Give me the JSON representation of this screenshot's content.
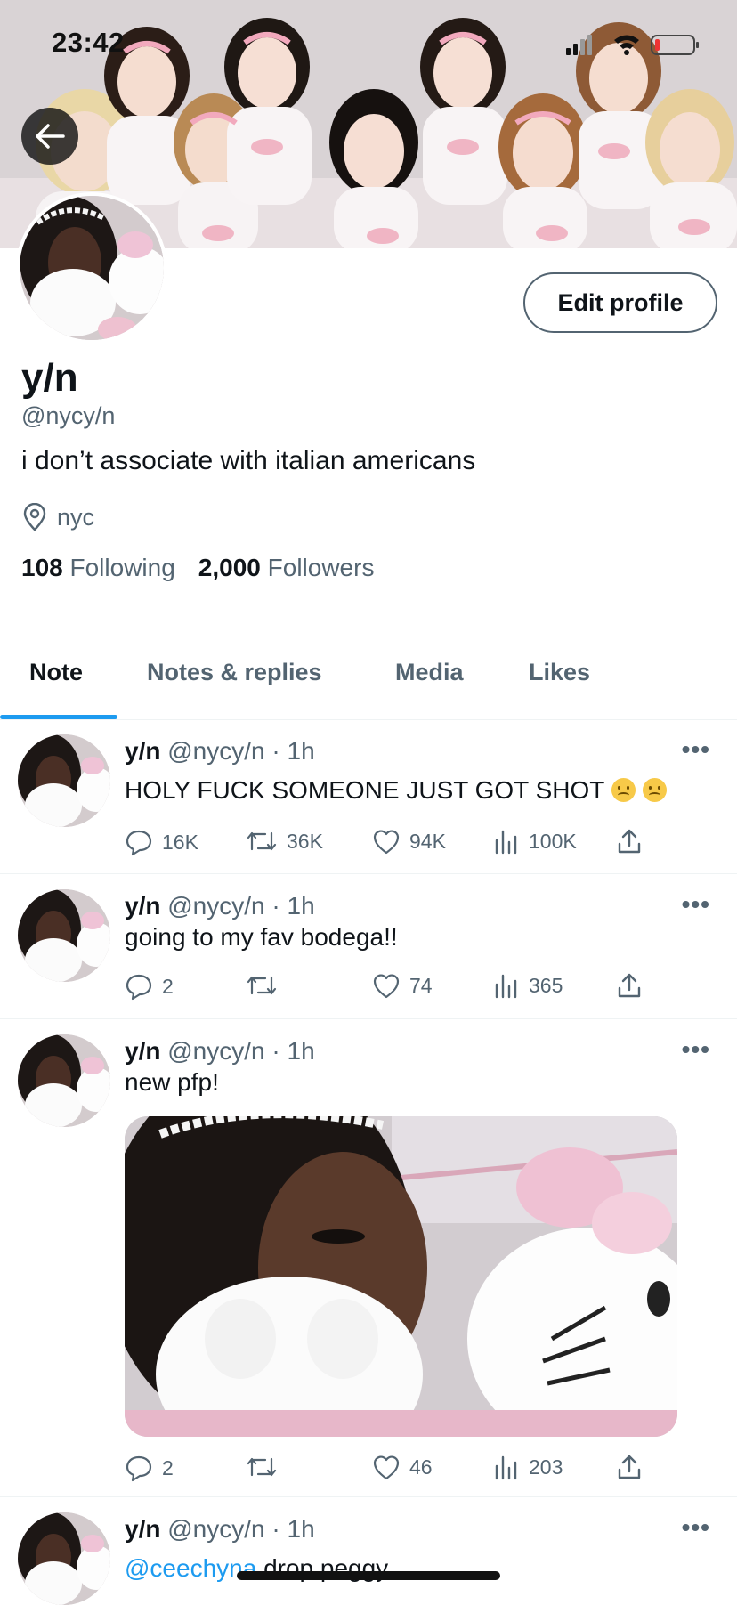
{
  "status_bar": {
    "time": "23:42"
  },
  "profile": {
    "display_name": "y/n",
    "handle": "@nycy/n",
    "bio": "i don’t associate with italian americans",
    "location": "nyc",
    "following_count": "108",
    "following_label": "Following",
    "followers_count": "2,000",
    "followers_label": "Followers",
    "edit_button": "Edit profile"
  },
  "tabs": [
    {
      "label": "Note",
      "active": true
    },
    {
      "label": "Notes & replies",
      "active": false
    },
    {
      "label": "Media",
      "active": false
    },
    {
      "label": "Likes",
      "active": false
    }
  ],
  "posts": [
    {
      "name": "y/n",
      "handle": "@nycy/n",
      "time": "· 1h",
      "text": "HOLY FUCK SOMEONE JUST GOT SHOT",
      "emoji_count": 2,
      "replies": "16K",
      "reposts": "36K",
      "likes": "94K",
      "views": "100K"
    },
    {
      "name": "y/n",
      "handle": "@nycy/n",
      "time": "· 1h",
      "text": "going to my fav bodega!!",
      "replies": "2",
      "reposts": "",
      "likes": "74",
      "views": "365"
    },
    {
      "name": "y/n",
      "handle": "@nycy/n",
      "time": "· 1h",
      "text": "new pfp!",
      "replies": "2",
      "reposts": "",
      "likes": "46",
      "views": "203"
    },
    {
      "name": "y/n",
      "handle": "@nycy/n",
      "time": "· 1h",
      "mention": "@ceechyna",
      "text": " drop peggy"
    }
  ],
  "more_icon_text": "•••",
  "colors": {
    "accent": "#1d9bf0",
    "secondary_text": "#536471",
    "primary_text": "#0f1419"
  }
}
